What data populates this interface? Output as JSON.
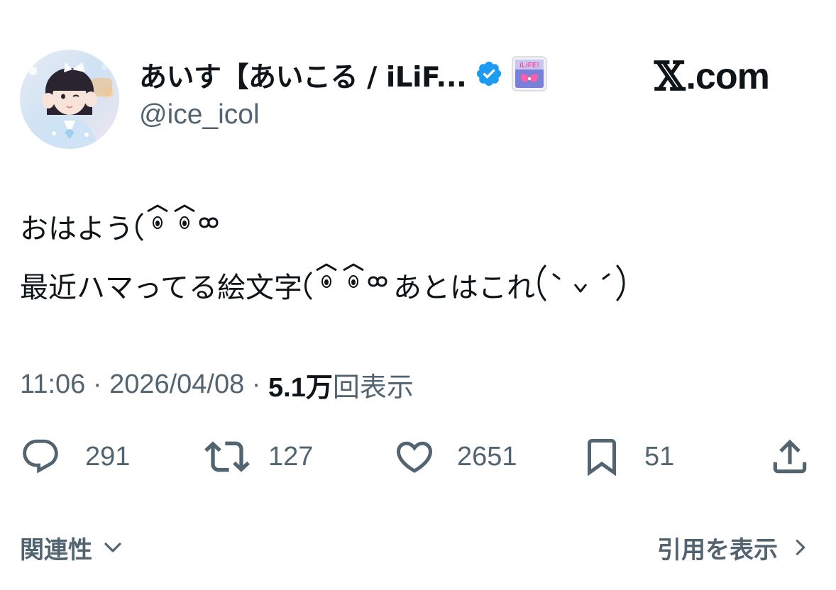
{
  "tweet": {
    "author": {
      "display_name": "あいす【あいこる / iLiF...",
      "handle": "@ice_icol",
      "verified_icon": "verified-badge-icon",
      "affiliate_badge_icon": "ilife-affiliate-badge-icon",
      "affiliate_badge_text": "iLiFE!"
    },
    "brand_label": "X.com",
    "brand_x_glyph": "𝕏",
    "brand_suffix": ".com",
    "text_line1": "おはよう",
    "text_line2_part1": "最近ハマってる絵文字",
    "text_line2_part2": "あとはこれ",
    "text_line2_kaomoji2": "(˵ ͡ ˅ ͡ ˵)",
    "meta": {
      "time": "11:06",
      "separator": " · ",
      "date": "2026/04/08",
      "views_count": "5.1万",
      "views_label": "回表示"
    },
    "actions": {
      "reply_count": "291",
      "retweet_count": "127",
      "like_count": "2651",
      "bookmark_count": "51"
    },
    "footer": {
      "related_label": "関連性",
      "quotes_label": "引用を表示"
    }
  },
  "colors": {
    "text_primary": "#0f1419",
    "text_secondary": "#536471",
    "verified_blue": "#1d9bf0"
  }
}
